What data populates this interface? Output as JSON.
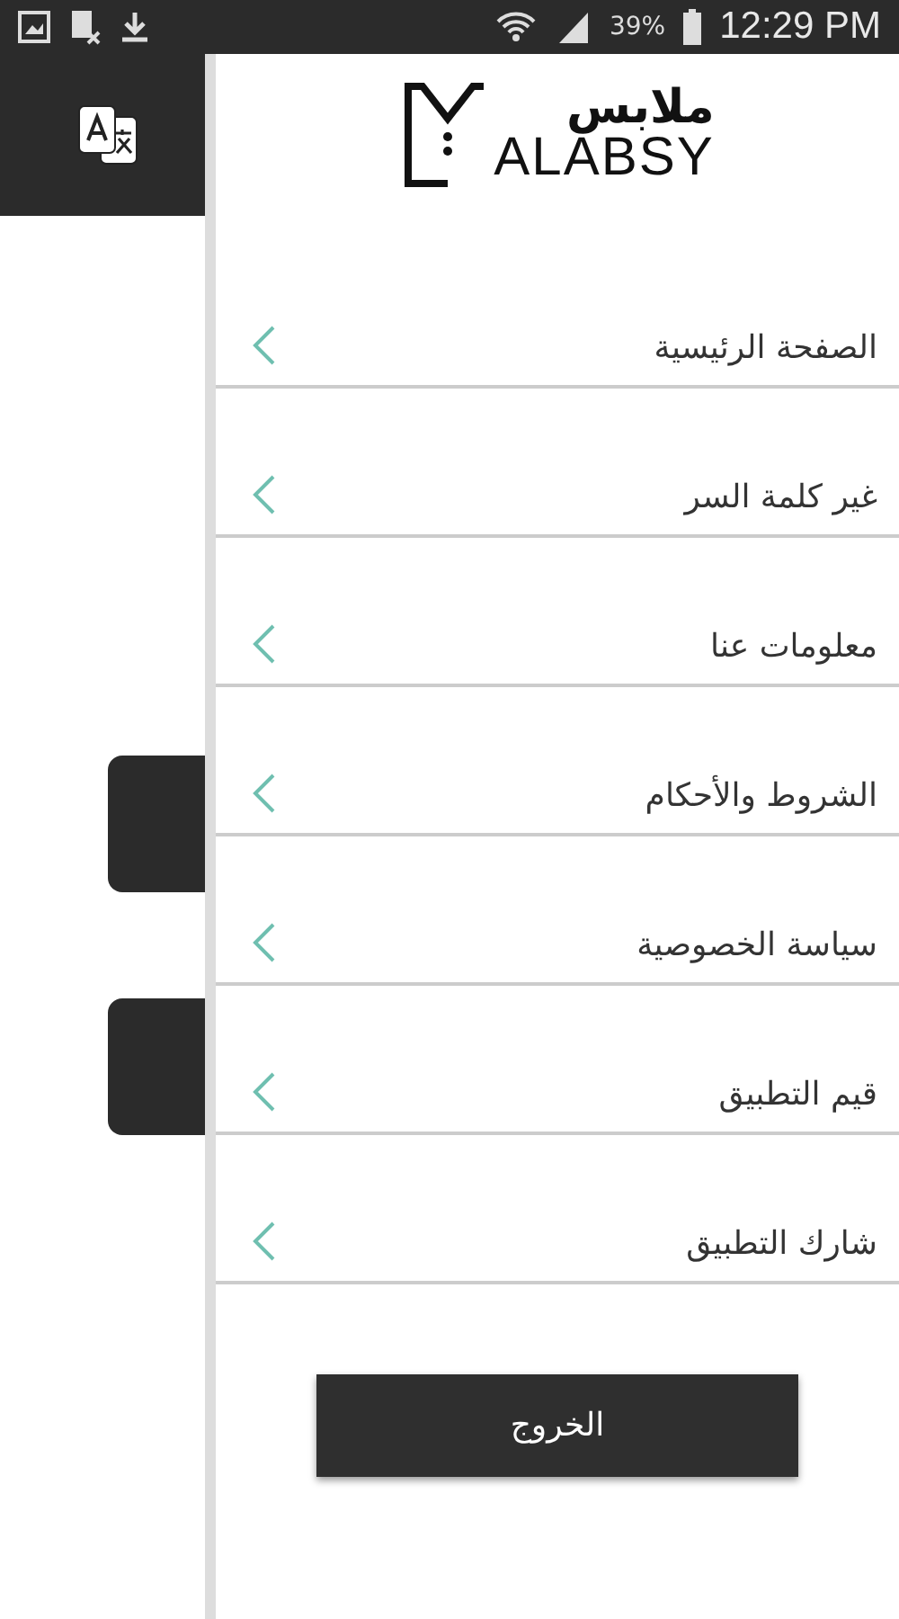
{
  "status_bar": {
    "battery": "39%",
    "time": "12:29 PM"
  },
  "logo": {
    "arabic": "ملابس",
    "latin": "ALABSY"
  },
  "menu": [
    {
      "label": "الصفحة الرئيسية"
    },
    {
      "label": "غير كلمة السر"
    },
    {
      "label": "معلومات عنا"
    },
    {
      "label": "الشروط والأحكام"
    },
    {
      "label": "سياسة الخصوصية"
    },
    {
      "label": "قيم التطبيق"
    },
    {
      "label": "شارك التطبيق"
    }
  ],
  "logout_button": "الخروج"
}
